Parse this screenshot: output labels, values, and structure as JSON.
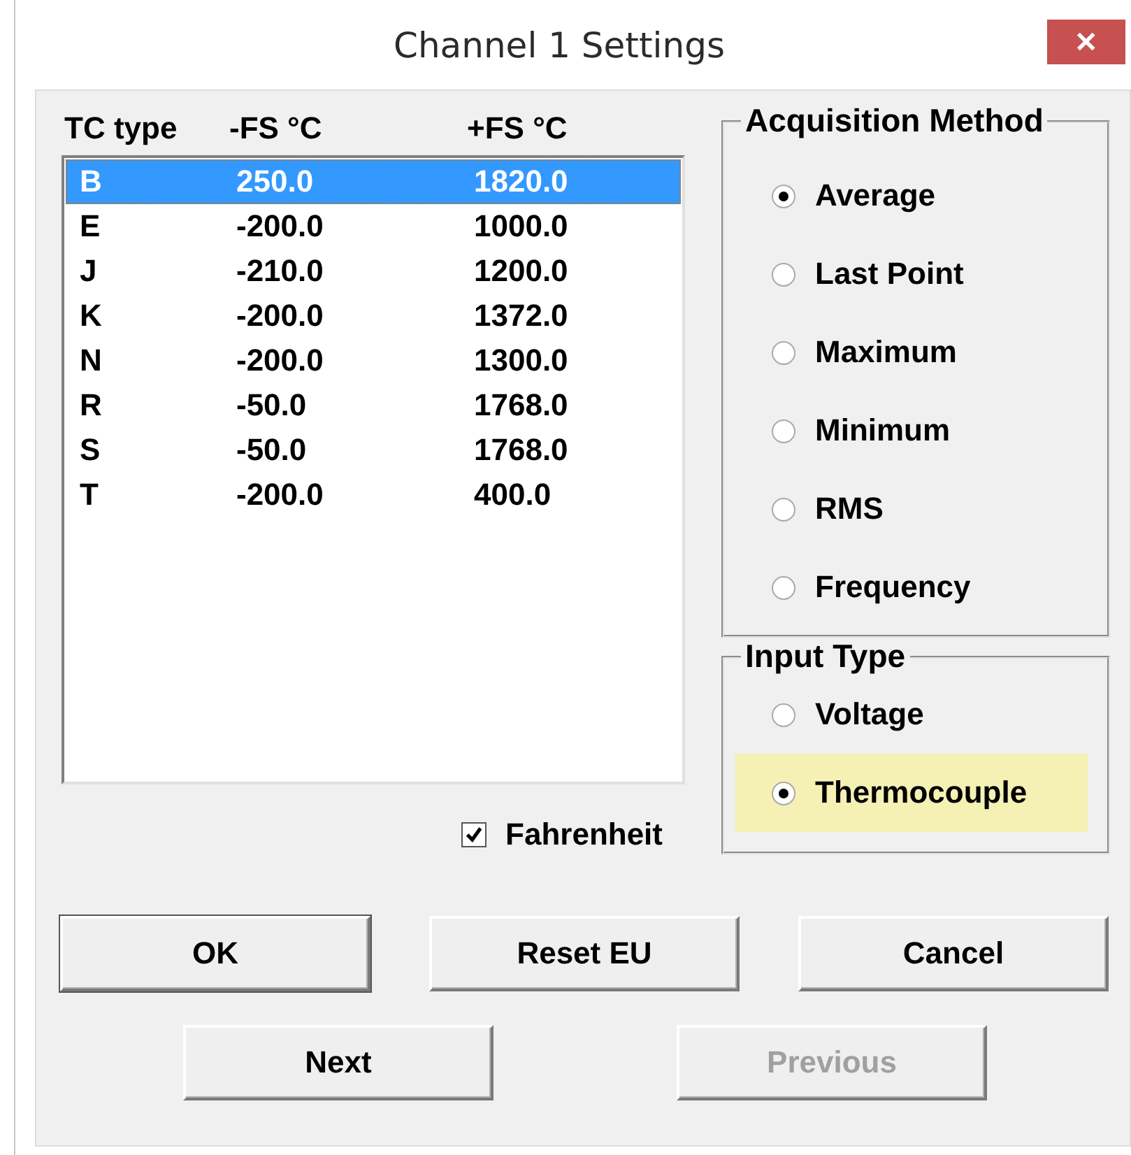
{
  "window": {
    "title": "Channel 1 Settings",
    "close": "✕"
  },
  "table": {
    "columns": [
      "TC type",
      "-FS °C",
      "+FS °C"
    ],
    "rows": [
      {
        "cells": [
          "B",
          "250.0",
          "1820.0"
        ],
        "selected": true
      },
      {
        "cells": [
          "E",
          "-200.0",
          "1000.0"
        ],
        "selected": false
      },
      {
        "cells": [
          "J",
          "-210.0",
          "1200.0"
        ],
        "selected": false
      },
      {
        "cells": [
          "K",
          "-200.0",
          "1372.0"
        ],
        "selected": false
      },
      {
        "cells": [
          "N",
          "-200.0",
          "1300.0"
        ],
        "selected": false
      },
      {
        "cells": [
          "R",
          "-50.0",
          "1768.0"
        ],
        "selected": false
      },
      {
        "cells": [
          "S",
          "-50.0",
          "1768.0"
        ],
        "selected": false
      },
      {
        "cells": [
          "T",
          "-200.0",
          "400.0"
        ],
        "selected": false
      }
    ]
  },
  "fahrenheit": {
    "label": "Fahrenheit",
    "checked": true
  },
  "acquisition_method": {
    "title": "Acquisition Method",
    "options": [
      {
        "label": "Average",
        "selected": true,
        "focused": false
      },
      {
        "label": "Last Point",
        "selected": false,
        "focused": false
      },
      {
        "label": "Maximum",
        "selected": false,
        "focused": false
      },
      {
        "label": "Minimum",
        "selected": false,
        "focused": false
      },
      {
        "label": "RMS",
        "selected": false,
        "focused": false
      },
      {
        "label": "Frequency",
        "selected": false,
        "focused": false
      }
    ]
  },
  "input_type": {
    "title": "Input Type",
    "options": [
      {
        "label": "Voltage",
        "selected": false,
        "focused": false
      },
      {
        "label": "Thermocouple",
        "selected": true,
        "focused": true
      }
    ]
  },
  "buttons": [
    {
      "label": "OK",
      "disabled": false,
      "default": true
    },
    {
      "label": "Reset EU",
      "disabled": false,
      "default": false
    },
    {
      "label": "Cancel",
      "disabled": false,
      "default": false
    }
  ],
  "nav_buttons": [
    {
      "label": "Next",
      "disabled": false,
      "default": false
    },
    {
      "label": "Previous",
      "disabled": true,
      "default": false
    }
  ]
}
